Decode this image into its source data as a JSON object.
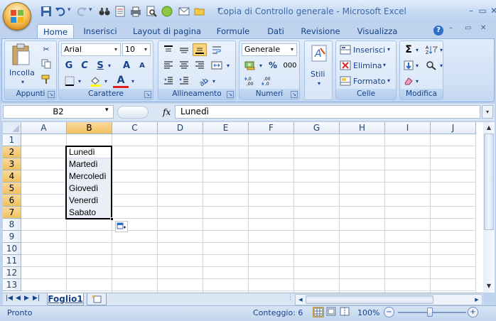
{
  "window": {
    "title": "Copia di Controllo generale - Microsoft Excel",
    "controls": {
      "minimize": "–",
      "restore": "▭",
      "close": "✕"
    }
  },
  "qat": [
    "save-icon",
    "undo-icon",
    "redo-icon",
    "binoculars-icon",
    "form-icon",
    "print-icon",
    "print-preview-icon",
    "green-circle-icon",
    "envelope-icon",
    "open-folder-icon"
  ],
  "tabs": [
    {
      "label": "Home",
      "active": true
    },
    {
      "label": "Inserisci"
    },
    {
      "label": "Layout di pagina"
    },
    {
      "label": "Formule"
    },
    {
      "label": "Dati"
    },
    {
      "label": "Revisione"
    },
    {
      "label": "Visualizza"
    }
  ],
  "ribbon": {
    "appunti": {
      "label": "Appunti",
      "paste": "Incolla"
    },
    "carattere": {
      "label": "Carattere",
      "font": "Arial",
      "size": "10",
      "bold": "G",
      "italic": "C",
      "underline": "S",
      "grow": "A",
      "shrink": "A",
      "font_color": "A"
    },
    "allineamento": {
      "label": "Allineamento"
    },
    "numeri": {
      "label": "Numeri",
      "format": "Generale",
      "percent": "%",
      "thousands": "000"
    },
    "stili": {
      "label": "Stili"
    },
    "celle": {
      "label": "Celle",
      "insert": "Inserisci",
      "delete": "Elimina",
      "format": "Formato"
    },
    "modifica": {
      "label": "Modifica",
      "sum": "Σ"
    }
  },
  "formula_bar": {
    "name_box": "B2",
    "fx": "fx",
    "content": "Lunedì"
  },
  "columns": [
    "A",
    "B",
    "C",
    "D",
    "E",
    "F",
    "G",
    "H",
    "I",
    "J"
  ],
  "rows": [
    "1",
    "2",
    "3",
    "4",
    "5",
    "6",
    "7",
    "8",
    "9",
    "10",
    "11",
    "12",
    "13"
  ],
  "cells": {
    "B2": "Lunedì",
    "B3": "Martedì",
    "B4": "Mercoledì",
    "B5": "Giovedì",
    "B6": "Venerdì",
    "B7": "Sabato"
  },
  "sheets": [
    "Foglio1"
  ],
  "status": {
    "ready": "Pronto",
    "count": "Conteggio: 6",
    "zoom": "100%"
  },
  "colors": {
    "accent": "#15428b",
    "selection_header": "#f1c15f",
    "ribbon": "#d0e0f6"
  }
}
